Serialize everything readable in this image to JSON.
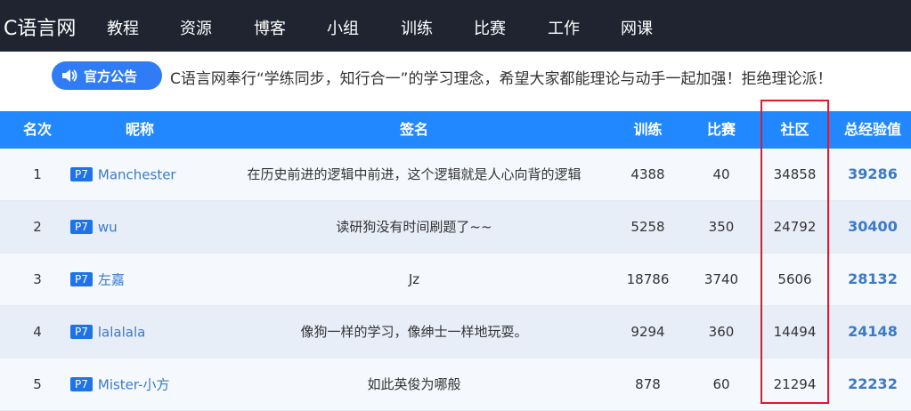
{
  "nav": {
    "brand": "C语言网",
    "items": [
      "教程",
      "资源",
      "博客",
      "小组",
      "训练",
      "比赛",
      "工作",
      "网课"
    ]
  },
  "notice": {
    "badge": "官方公告",
    "text": "C语言网奉行“学练同步，知行合一”的学习理念，希望大家都能理论与动手一起加强！拒绝理论派！"
  },
  "table": {
    "headers": {
      "rank": "名次",
      "nickname": "昵称",
      "signature": "签名",
      "training": "训练",
      "contest": "比赛",
      "community": "社区",
      "total": "总经验值"
    },
    "rows": [
      {
        "rank": "1",
        "level": "P7",
        "nickname": "Manchester",
        "signature": "在历史前进的逻辑中前进，这个逻辑就是人心向背的逻辑",
        "training": "4388",
        "contest": "40",
        "community": "34858",
        "total": "39286"
      },
      {
        "rank": "2",
        "level": "P7",
        "nickname": "wu",
        "signature": "读研狗没有时间刷题了~~",
        "training": "5258",
        "contest": "350",
        "community": "24792",
        "total": "30400"
      },
      {
        "rank": "3",
        "level": "P7",
        "nickname": "左嘉",
        "signature": "Jz",
        "training": "18786",
        "contest": "3740",
        "community": "5606",
        "total": "28132"
      },
      {
        "rank": "4",
        "level": "P7",
        "nickname": "lalalala",
        "signature": "像狗一样的学习，像绅士一样地玩耍。",
        "training": "9294",
        "contest": "360",
        "community": "14494",
        "total": "24148"
      },
      {
        "rank": "5",
        "level": "P7",
        "nickname": "Mister-小方",
        "signature": "如此英俊为哪般",
        "training": "878",
        "contest": "60",
        "community": "21294",
        "total": "22232"
      }
    ]
  },
  "colors": {
    "nav_bg": "#1f2430",
    "header_bg": "#2188ff",
    "row_alt_bg": "#e8eef8",
    "row_bg": "#f5f8fc",
    "badge_bg": "#2f7cf6",
    "level_bg": "#1e73e8",
    "link": "#3a7ac9",
    "highlight": "#e0192c"
  }
}
